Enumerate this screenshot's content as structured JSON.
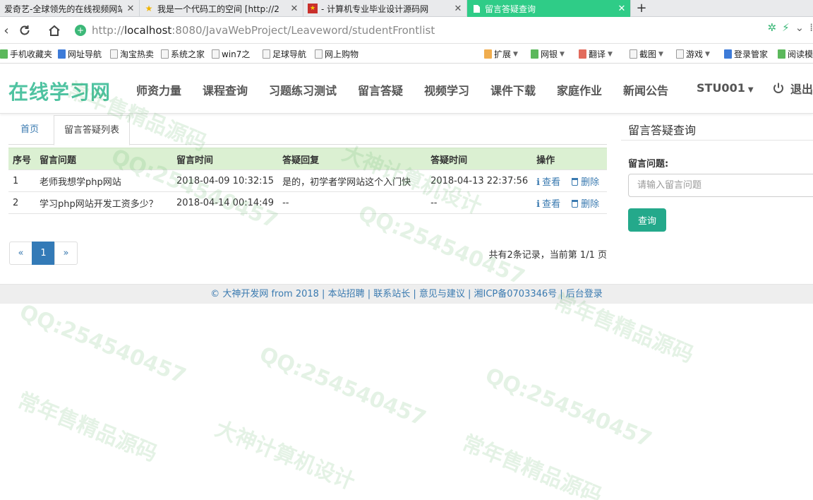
{
  "browser": {
    "tabs": [
      {
        "title": "爱奇艺-全球领先的在线视频网站",
        "active": false
      },
      {
        "title": "我是一个代码工的空间 [http://2",
        "active": false
      },
      {
        "title": "- 计算机专业毕业设计源码网",
        "active": false
      },
      {
        "title": "留言答疑查询",
        "active": true
      }
    ],
    "new_tab": "+",
    "url_host": "localhost",
    "url_rest": ":8080/JavaWebProject/Leaveword/studentFrontlist",
    "url_scheme": "http://"
  },
  "bookmarks": {
    "left": [
      "手机收藏夹",
      "网址导航",
      "淘宝热卖",
      "系统之家",
      "win7之",
      "足球导航",
      "网上购物"
    ],
    "right": [
      "扩展",
      "网银",
      "翻译",
      "截图",
      "游戏",
      "登录管家",
      "阅读模"
    ]
  },
  "site": {
    "logo": "在线学习网",
    "menu": [
      "师资力量",
      "课程查询",
      "习题练习测试",
      "留言答疑",
      "视频学习",
      "课件下载",
      "家庭作业",
      "新闻公告"
    ],
    "user": "STU001",
    "logout": "退出"
  },
  "content": {
    "tabs": [
      "首页",
      "留言答疑列表"
    ],
    "table": {
      "headers": [
        "序号",
        "留言问题",
        "留言时间",
        "答疑回复",
        "答疑时间",
        "操作"
      ],
      "rows": [
        {
          "no": "1",
          "question": "老师我想学php网站",
          "time": "2018-04-09 10:32:15",
          "reply": "是的，初学者学网站这个入门快",
          "reply_time": "2018-04-13 22:37:56"
        },
        {
          "no": "2",
          "question": "学习php网站开发工资多少？",
          "time": "2018-04-14 00:14:49",
          "reply": "--",
          "reply_time": "--"
        }
      ],
      "view_label": "查看",
      "delete_label": "删除"
    },
    "pager": {
      "prev": "«",
      "current": "1",
      "next": "»"
    },
    "summary": "共有2条记录，当前第 1/1 页"
  },
  "sidebar": {
    "title": "留言答疑查询",
    "label": "留言问题:",
    "placeholder": "请输入留言问题",
    "button": "查询"
  },
  "footer": {
    "text": "© 大神开发网 from 2018 | 本站招聘 | 联系站长 | 意见与建议 | 湘ICP备0703346号 | 后台登录"
  },
  "watermark": {
    "lines": [
      "大神计算机设计",
      "常年售精品源码",
      "QQ:254540457"
    ]
  },
  "colors": {
    "active_tab": "#2fcc87",
    "logo": "#4fc3a1",
    "table_header": "#dbf0d2",
    "search_button": "#24a98b",
    "link": "#3a7ab0",
    "pager_active": "#337ab7"
  }
}
